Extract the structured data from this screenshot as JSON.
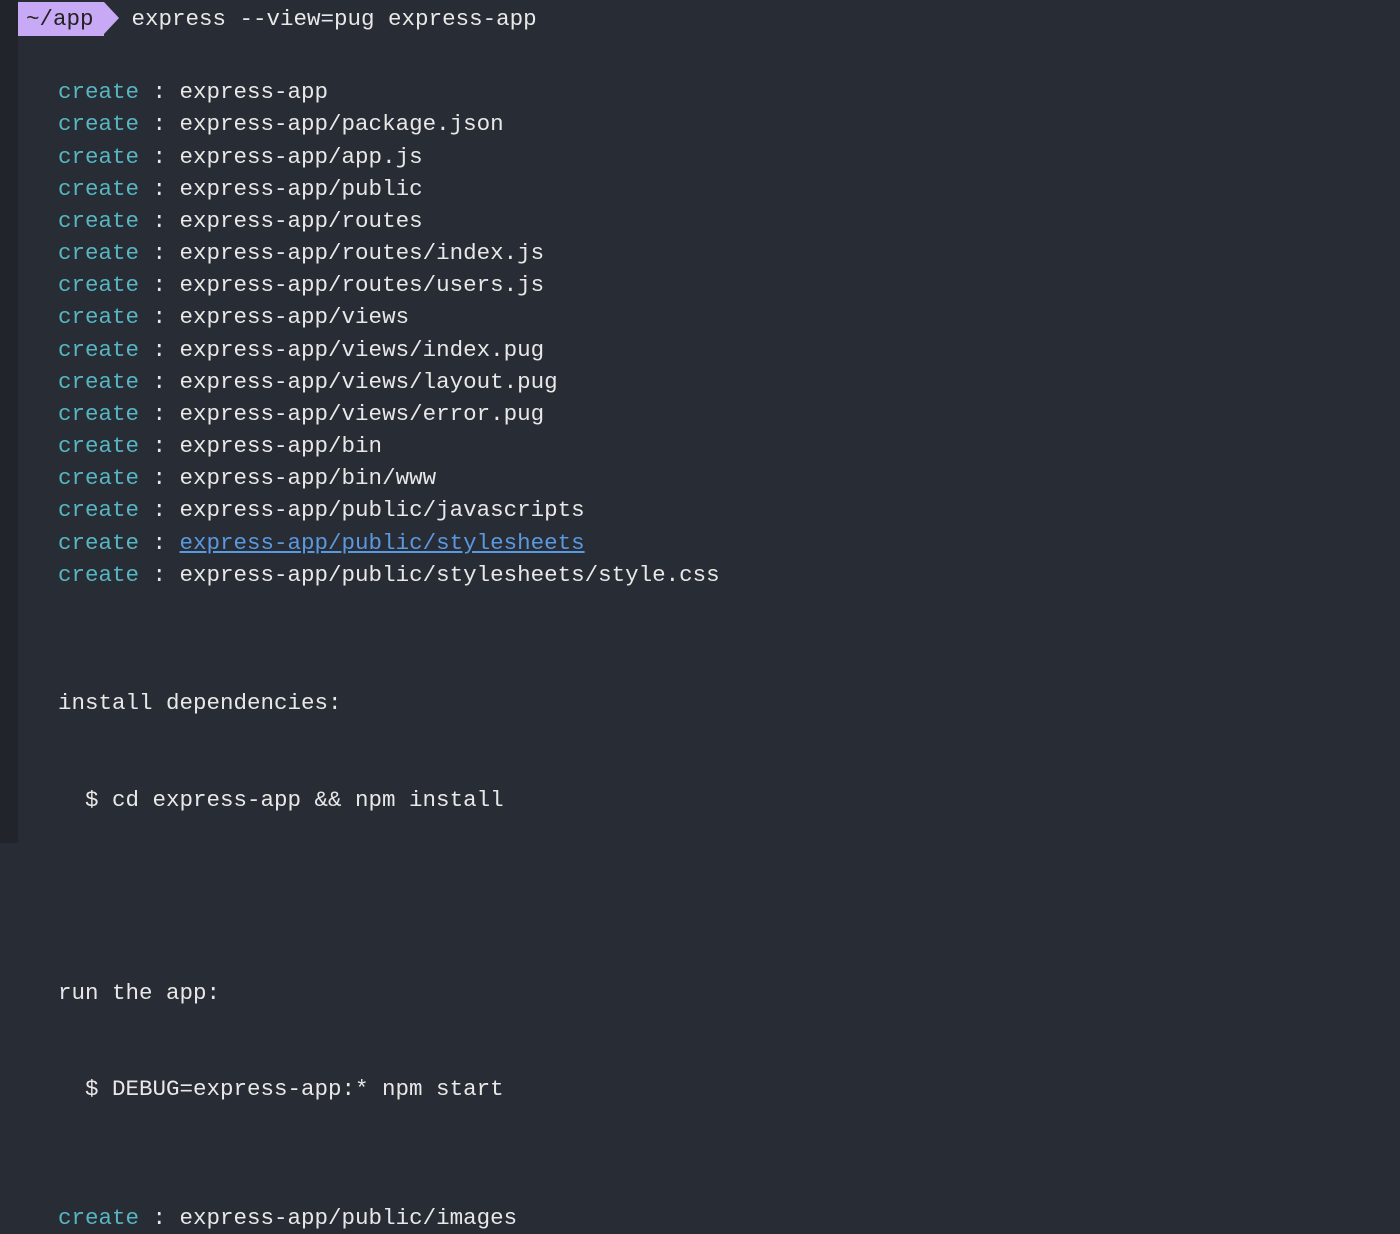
{
  "prompt": {
    "cwd": "~/app",
    "command": "express --view=pug express-app"
  },
  "create_label": "create",
  "sep": " : ",
  "creates": [
    {
      "path": "express-app",
      "link": false
    },
    {
      "path": "express-app/package.json",
      "link": false
    },
    {
      "path": "express-app/app.js",
      "link": false
    },
    {
      "path": "express-app/public",
      "link": false
    },
    {
      "path": "express-app/routes",
      "link": false
    },
    {
      "path": "express-app/routes/index.js",
      "link": false
    },
    {
      "path": "express-app/routes/users.js",
      "link": false
    },
    {
      "path": "express-app/views",
      "link": false
    },
    {
      "path": "express-app/views/index.pug",
      "link": false
    },
    {
      "path": "express-app/views/layout.pug",
      "link": false
    },
    {
      "path": "express-app/views/error.pug",
      "link": false
    },
    {
      "path": "express-app/bin",
      "link": false
    },
    {
      "path": "express-app/bin/www",
      "link": false
    },
    {
      "path": "express-app/public/javascripts",
      "link": false
    },
    {
      "path": "express-app/public/stylesheets",
      "link": true
    },
    {
      "path": "express-app/public/stylesheets/style.css",
      "link": false
    }
  ],
  "install": {
    "heading": "install dependencies:",
    "cmd": "  $ cd express-app && npm install"
  },
  "run": {
    "heading": "run the app:",
    "cmd": "  $ DEBUG=express-app:* npm start"
  },
  "trailing_create": {
    "path": "express-app/public/images",
    "link": false
  }
}
